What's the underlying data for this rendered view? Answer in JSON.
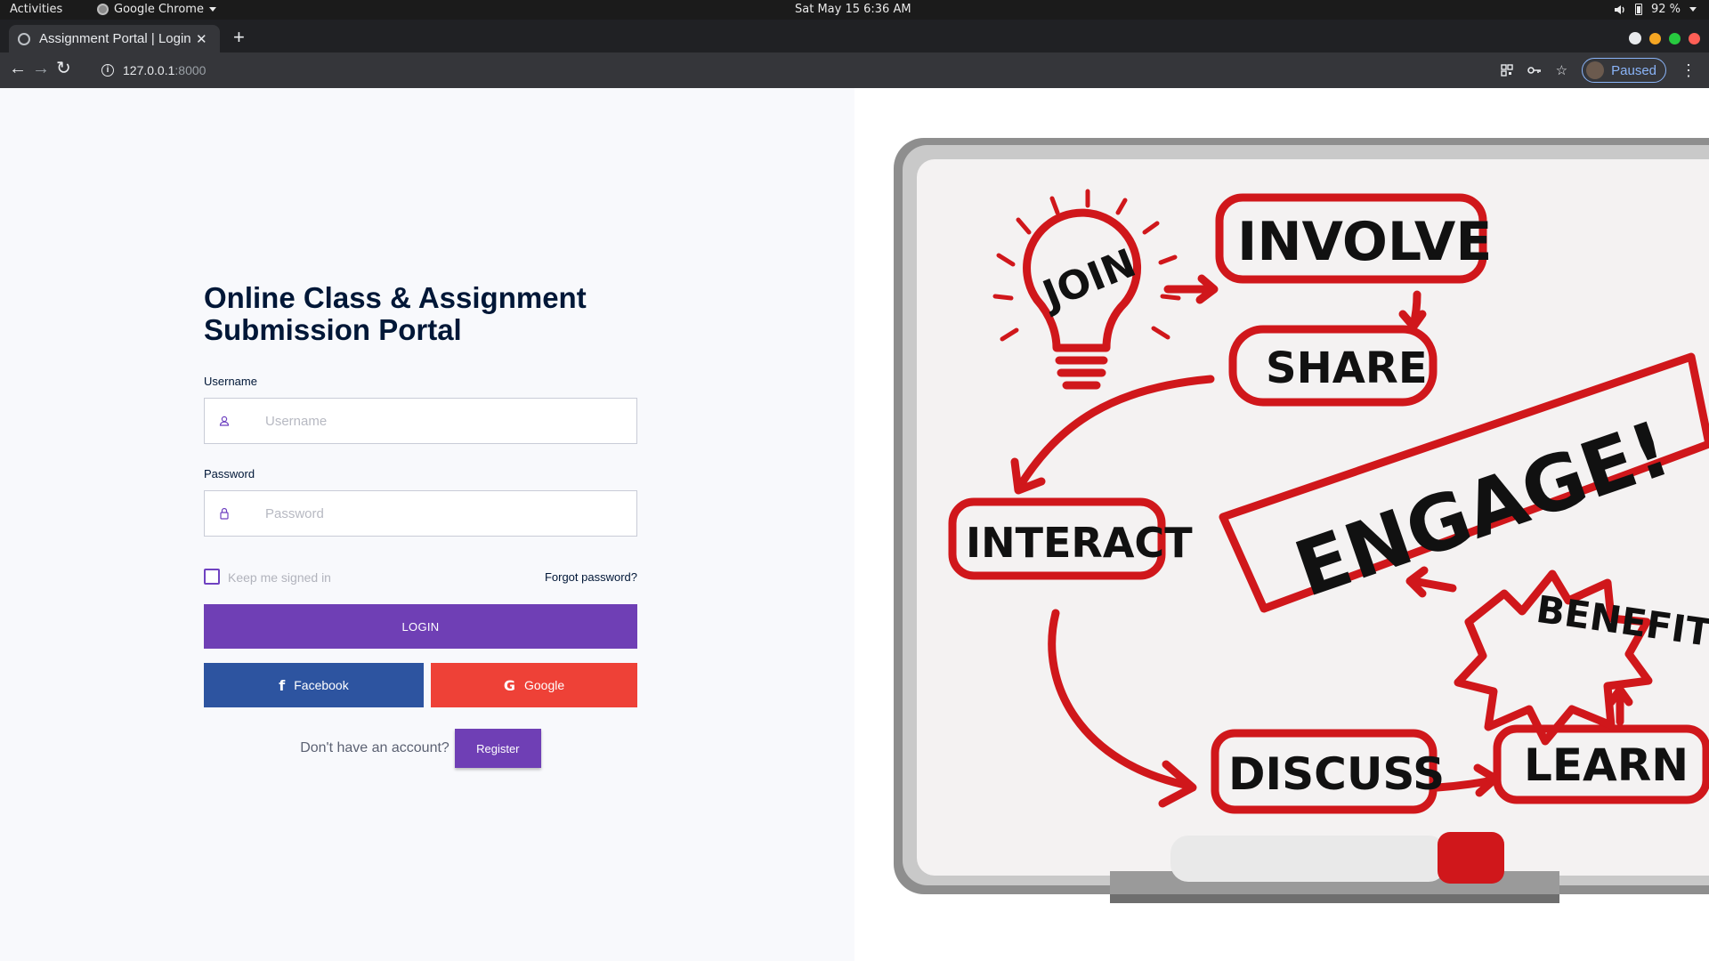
{
  "system_bar": {
    "activities": "Activities",
    "app_name": "Google Chrome",
    "clock": "Sat May 15   6:36 AM",
    "battery": "92 %"
  },
  "browser": {
    "tab_title": "Assignment Portal | Login",
    "url_host": "127.0.0.1",
    "url_port": ":8000",
    "profile_status": "Paused"
  },
  "login": {
    "heading": "Online Class & Assignment Submission Portal",
    "username_label": "Username",
    "username_placeholder": "Username",
    "password_label": "Password",
    "password_placeholder": "Password",
    "keep_signed_in": "Keep me signed in",
    "forgot_password": "Forgot password?",
    "login_button": "LOGIN",
    "facebook_button": "Facebook",
    "google_button": "Google",
    "no_account_text": "Don't have an account?",
    "register_button": "Register"
  },
  "illustration": {
    "words": {
      "join": "JOIN",
      "involve": "INVOLVE",
      "share": "SHARE",
      "engage": "ENGAGE!",
      "interact": "INTERACT",
      "benefit": "BENEFIT",
      "discuss": "DISCUSS",
      "learn": "LEARN"
    }
  },
  "colors": {
    "accent_purple": "#6f3fb5",
    "facebook_blue": "#2d54a0",
    "google_red": "#ee4137",
    "heading_navy": "#001737",
    "marker_red": "#d0171b"
  }
}
